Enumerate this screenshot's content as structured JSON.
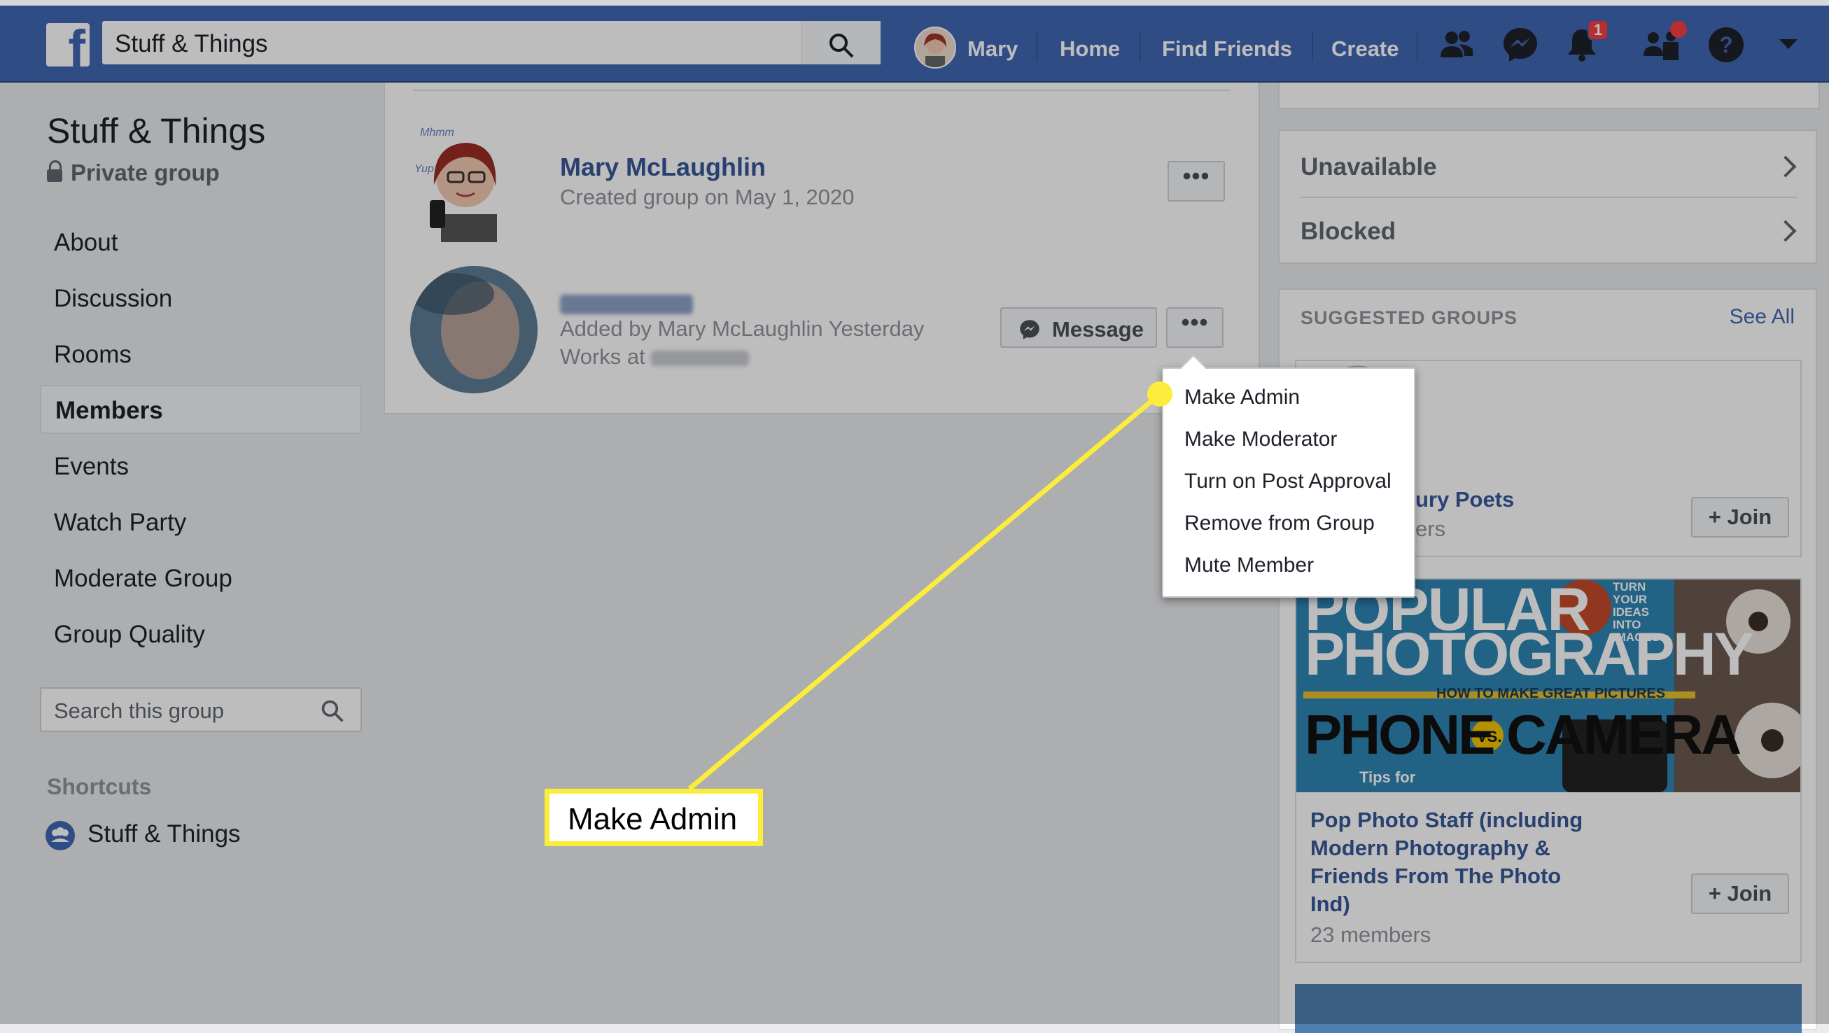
{
  "topbar": {
    "search_value": "Stuff & Things",
    "profile_name": "Mary",
    "nav": [
      "Home",
      "Find Friends",
      "Create"
    ],
    "notification_count": "1"
  },
  "sidebar": {
    "group_name": "Stuff & Things",
    "privacy": "Private group",
    "items": [
      {
        "label": "About"
      },
      {
        "label": "Discussion"
      },
      {
        "label": "Rooms"
      },
      {
        "label": "Members",
        "active": true
      },
      {
        "label": "Events"
      },
      {
        "label": "Watch Party"
      },
      {
        "label": "Moderate Group"
      },
      {
        "label": "Group Quality"
      }
    ],
    "search_placeholder": "Search this group",
    "shortcuts_label": "Shortcuts",
    "shortcut_item": "Stuff & Things"
  },
  "members": [
    {
      "name": "Mary McLaughlin",
      "meta": "Created group on May 1, 2020"
    },
    {
      "meta": "Added by Mary McLaughlin Yesterday",
      "works_prefix": "Works at",
      "message_label": "Message"
    }
  ],
  "more_button_label": "•••",
  "dropdown": [
    "Make Admin",
    "Make Moderator",
    "Turn on Post Approval",
    "Remove from Group",
    "Mute Member"
  ],
  "right": {
    "rows": [
      "Unavailable",
      "Blocked"
    ],
    "suggested_header": "SUGGESTED GROUPS",
    "see_all": "See All",
    "suggested": [
      {
        "title_fragment": "ury Poets",
        "members_fragment": "ers",
        "join_label": "+ Join"
      },
      {
        "title": "Pop Photo Staff (including Modern Photography & Friends From The Photo Ind)",
        "members": "23 members",
        "join_label": "+ Join",
        "cover": {
          "line1": "POPULAR",
          "line2": "PHOTOGRAPHY",
          "tagline": "HOW TO MAKE GREAT PICTURES",
          "line3": "PHONE",
          "vs": "VS.",
          "line4": "CAMERA",
          "badge": "TURN YOUR IDEAS INTO IMAGES",
          "tips": "Tips for"
        }
      }
    ]
  },
  "callout": {
    "label": "Make Admin",
    "color": "#fcec3b"
  },
  "colors": {
    "brand": "#4267b2",
    "link": "#385898"
  }
}
